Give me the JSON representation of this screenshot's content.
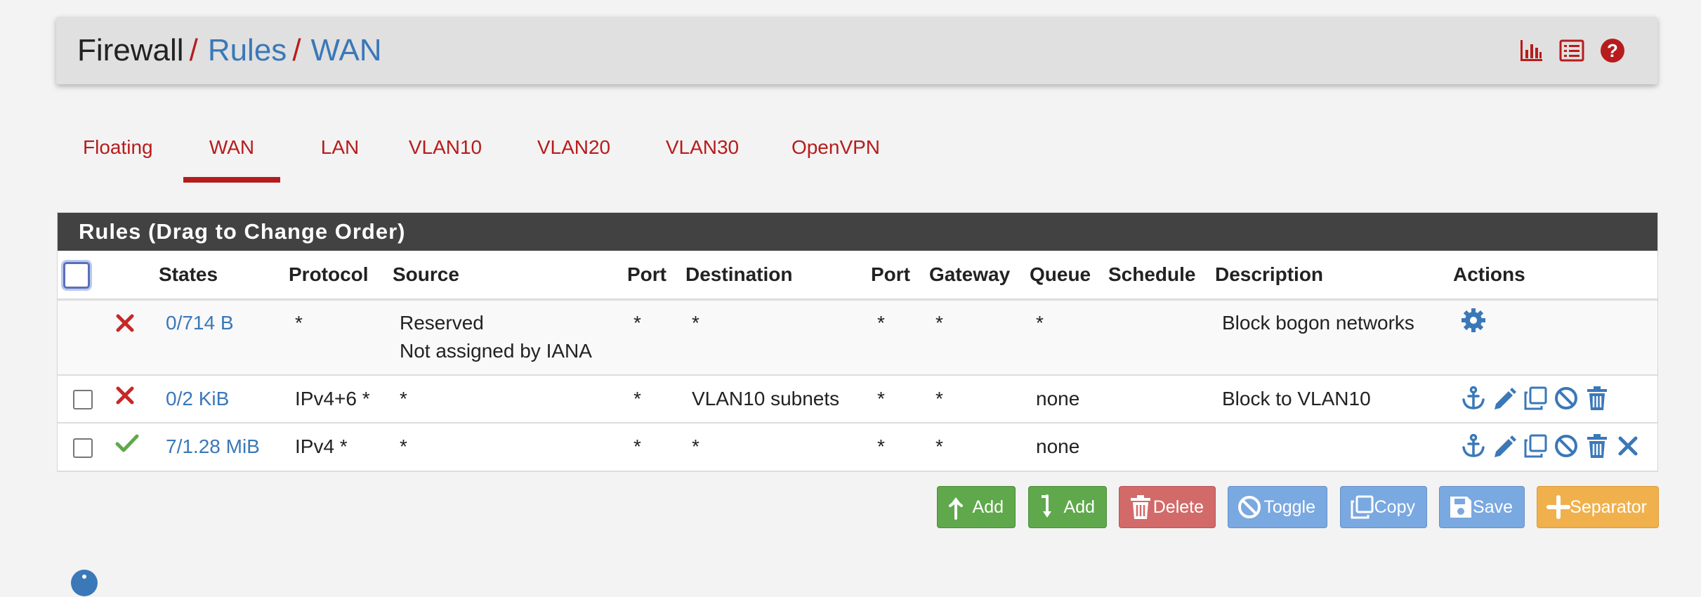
{
  "breadcrumb": {
    "root": "Firewall",
    "sep": "/",
    "items": [
      "Rules",
      "WAN"
    ]
  },
  "header_icons": [
    "bar-chart-icon",
    "list-icon",
    "help-icon"
  ],
  "tabs": [
    {
      "label": "Floating",
      "active": false
    },
    {
      "label": "WAN",
      "active": true
    },
    {
      "label": "LAN",
      "active": false
    },
    {
      "label": "VLAN10",
      "active": false
    },
    {
      "label": "VLAN20",
      "active": false
    },
    {
      "label": "VLAN30",
      "active": false
    },
    {
      "label": "OpenVPN",
      "active": false
    }
  ],
  "panel": {
    "title": "Rules (Drag to Change Order)"
  },
  "table": {
    "headers": {
      "states": "States",
      "protocol": "Protocol",
      "source": "Source",
      "src_port": "Port",
      "destination": "Destination",
      "dst_port": "Port",
      "gateway": "Gateway",
      "queue": "Queue",
      "schedule": "Schedule",
      "description": "Description",
      "actions": "Actions"
    },
    "rows": [
      {
        "status": "block",
        "states": "0/714 B",
        "protocol": "*",
        "source_line1": "Reserved",
        "source_line2": "Not assigned by IANA",
        "src_port": "*",
        "destination": "*",
        "dst_port": "*",
        "gateway": "*",
        "queue": "*",
        "schedule": "",
        "description": "Block bogon networks",
        "actions": [
          "gear-icon"
        ]
      },
      {
        "status": "block",
        "states": "0/2 KiB",
        "protocol": "IPv4+6 *",
        "source": "*",
        "src_port": "*",
        "destination": "VLAN10 subnets",
        "dst_port": "*",
        "gateway": "*",
        "queue": "none",
        "schedule": "",
        "description": "Block to VLAN10",
        "actions": [
          "anchor-icon",
          "pencil-icon",
          "copy-icon",
          "disable-icon",
          "trash-icon"
        ]
      },
      {
        "status": "pass",
        "states": "7/1.28 MiB",
        "protocol": "IPv4 *",
        "source": "*",
        "src_port": "*",
        "destination": "*",
        "dst_port": "*",
        "gateway": "*",
        "queue": "none",
        "schedule": "",
        "description": "",
        "actions": [
          "anchor-icon",
          "pencil-icon",
          "copy-icon",
          "disable-icon",
          "trash-icon",
          "close-icon"
        ]
      }
    ]
  },
  "buttons": {
    "add_top": "Add",
    "add_bottom": "Add",
    "delete": "Delete",
    "toggle": "Toggle",
    "copy": "Copy",
    "save": "Save",
    "separator": "Separator"
  },
  "colors": {
    "brand_red": "#b71c1c",
    "link_blue": "#3a78b8",
    "panel_header": "#424242",
    "pass_green": "#5fa84b"
  }
}
